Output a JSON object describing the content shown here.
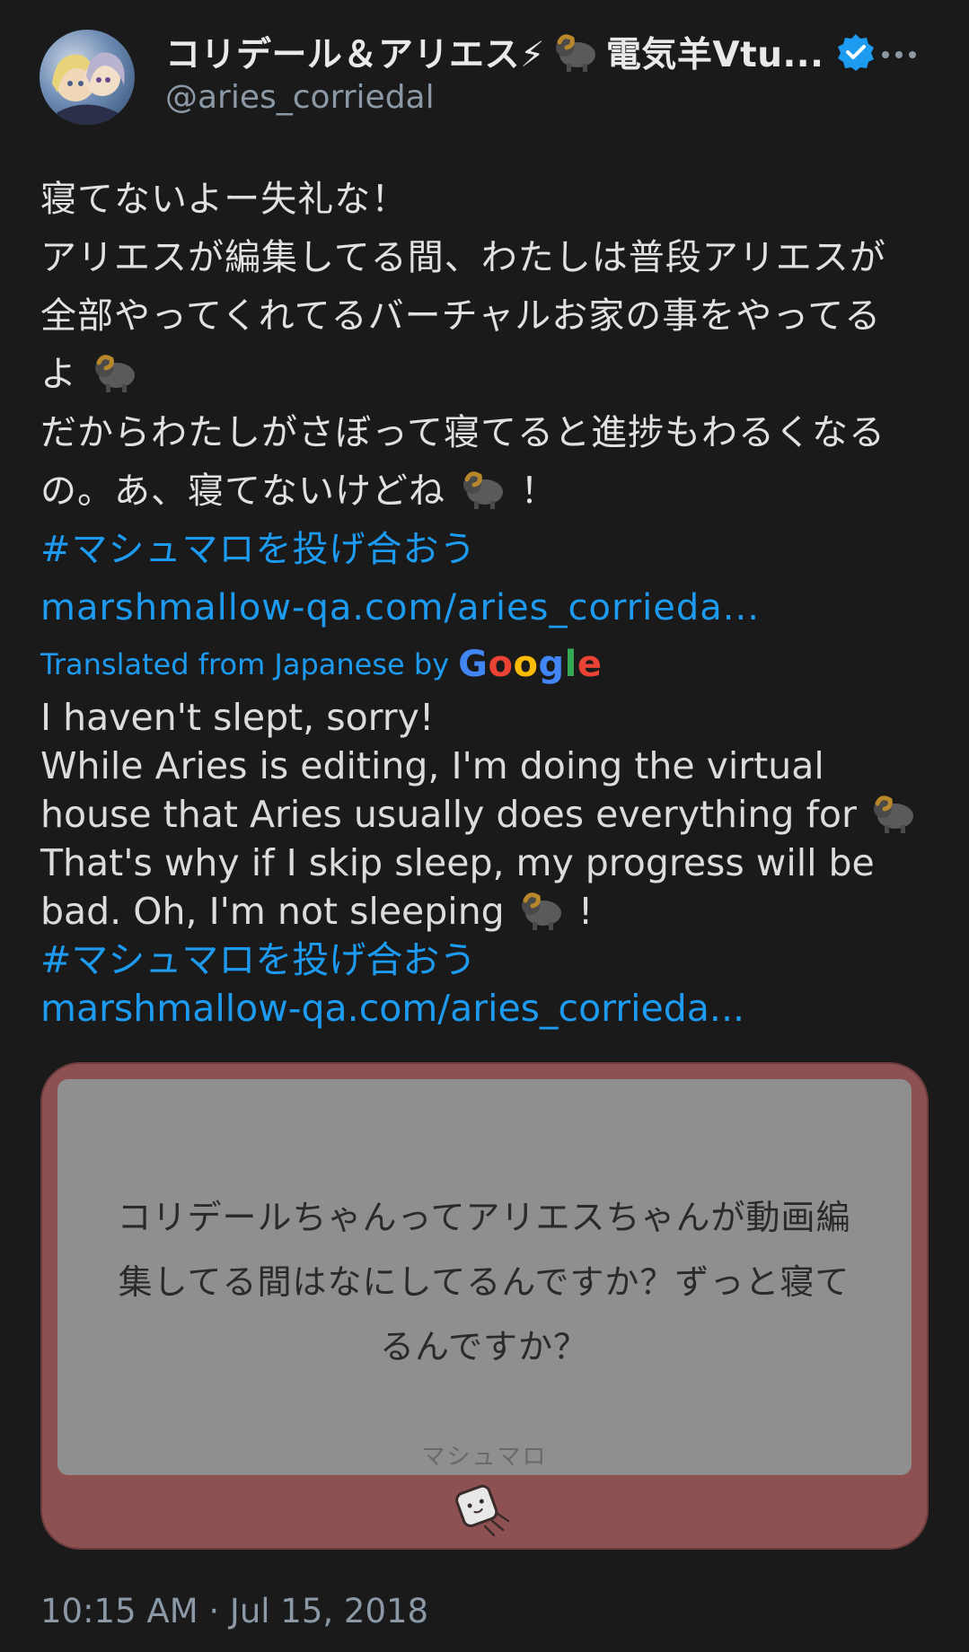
{
  "header": {
    "display_name": "コリデール＆アリエス⚡",
    "display_name_suffix": "電気羊Vtu...",
    "handle": "@aries_corriedal",
    "more_icon": "more-horizontal-icon",
    "verified_icon": "verified-badge-icon"
  },
  "tweet_jp": {
    "line1": "寝てないよー失礼な！",
    "line2": "アリエスが編集してる間、わたしは普段アリエスが",
    "line3": "全部やってくれてるバーチャルお家の事をやってる",
    "line4": "よ",
    "line5": "だからわたしがさぼって寝てると進捗もわるくなる",
    "line6a": "の。あ、寝てないけどね",
    "line6b": "！",
    "hashtag": "#マシュマロを投げ合おう",
    "link": "marshmallow-qa.com/aries_corrieda..."
  },
  "translation": {
    "label": "Translated from Japanese by",
    "google_letters": [
      "G",
      "o",
      "o",
      "g",
      "l",
      "e"
    ]
  },
  "tweet_en": {
    "line1": "I haven't slept, sorry!",
    "line2": "While Aries is editing, I'm doing the virtual",
    "line3": "house that Aries usually does everything for",
    "line4": "That's why if I skip sleep, my progress will be",
    "line5a": "bad. Oh, I'm not sleeping",
    "line5b": "!",
    "hashtag": "#マシュマロを投げ合おう",
    "link": "marshmallow-qa.com/aries_corrieda..."
  },
  "card": {
    "question_line1": "コリデールちゃんってアリエスちゃんが動画編",
    "question_line2": "集してる間はなにしてるんですか？ずっと寝て",
    "question_line3": "るんですか？",
    "brand": "マシュマロ",
    "icon": "marshmallow-icon"
  },
  "timestamp": "10:15 AM · Jul 15, 2018",
  "colors": {
    "background": "#1a1a1b",
    "link": "#1d9bf0",
    "card_frame": "#8e5152",
    "card_inner": "#8f8f8f",
    "muted": "#8b98a5"
  }
}
